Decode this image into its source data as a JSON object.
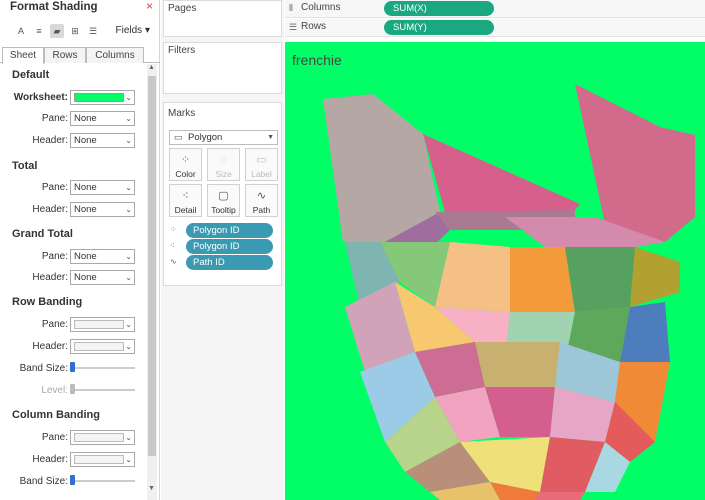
{
  "format_pane": {
    "title": "Format Shading",
    "fields_label": "Fields",
    "tabs": [
      "Sheet",
      "Rows",
      "Columns"
    ],
    "sections": {
      "default": {
        "title": "Default",
        "worksheet_label": "Worksheet:",
        "worksheet_color": "#00ff66",
        "pane_label": "Pane:",
        "pane_value": "None",
        "header_label": "Header:",
        "header_value": "None"
      },
      "total": {
        "title": "Total",
        "pane_label": "Pane:",
        "pane_value": "None",
        "header_label": "Header:",
        "header_value": "None"
      },
      "grand_total": {
        "title": "Grand Total",
        "pane_label": "Pane:",
        "pane_value": "None",
        "header_label": "Header:",
        "header_value": "None"
      },
      "row_banding": {
        "title": "Row Banding",
        "pane_label": "Pane:",
        "header_label": "Header:",
        "band_size_label": "Band Size:",
        "level_label": "Level:"
      },
      "column_banding": {
        "title": "Column Banding",
        "pane_label": "Pane:",
        "header_label": "Header:",
        "band_size_label": "Band Size:"
      }
    }
  },
  "cards": {
    "pages": "Pages",
    "filters": "Filters",
    "marks": {
      "title": "Marks",
      "type": "Polygon",
      "buttons": [
        "Color",
        "Size",
        "Label",
        "Detail",
        "Tooltip",
        "Path"
      ],
      "pills": [
        "Polygon ID",
        "Polygon ID",
        "Path ID"
      ]
    }
  },
  "shelves": {
    "columns": {
      "label": "Columns",
      "pill": "SUM(X)"
    },
    "rows": {
      "label": "Rows",
      "pill": "SUM(Y)"
    }
  },
  "viz": {
    "title": "frenchie",
    "background": "#00ff66",
    "polygons": [
      {
        "points": [
          [
            38,
            57
          ],
          [
            88,
            52
          ],
          [
            138,
            92
          ],
          [
            155,
            170
          ],
          [
            100,
            200
          ],
          [
            58,
            200
          ]
        ],
        "color": "#b5a7a3"
      },
      {
        "points": [
          [
            290,
            42
          ],
          [
            375,
            85
          ],
          [
            410,
            93
          ],
          [
            410,
            175
          ],
          [
            380,
            200
          ],
          [
            320,
            182
          ]
        ],
        "color": "#d26a8c"
      },
      {
        "points": [
          [
            138,
            92
          ],
          [
            165,
            188
          ],
          [
            250,
            188
          ],
          [
            290,
            168
          ],
          [
            295,
            162
          ]
        ],
        "color": "#d65f8c"
      },
      {
        "points": [
          [
            70,
            200
          ],
          [
            100,
            200
          ],
          [
            155,
            170
          ],
          [
            165,
            188
          ],
          [
            125,
            225
          ]
        ],
        "color": "#a06e9e"
      },
      {
        "points": [
          [
            150,
            170
          ],
          [
            290,
            168
          ],
          [
            290,
            188
          ],
          [
            165,
            188
          ]
        ],
        "color": "#a97a92"
      },
      {
        "points": [
          [
            220,
            175
          ],
          [
            310,
            175
          ],
          [
            380,
            200
          ],
          [
            350,
            205
          ],
          [
            260,
            205
          ]
        ],
        "color": "#d38aac"
      },
      {
        "points": [
          [
            60,
            200
          ],
          [
            95,
            200
          ],
          [
            115,
            240
          ],
          [
            75,
            265
          ]
        ],
        "color": "#7eb5b0"
      },
      {
        "points": [
          [
            95,
            200
          ],
          [
            165,
            200
          ],
          [
            150,
            265
          ],
          [
            115,
            240
          ]
        ],
        "color": "#86c87a"
      },
      {
        "points": [
          [
            165,
            200
          ],
          [
            225,
            205
          ],
          [
            225,
            270
          ],
          [
            150,
            265
          ]
        ],
        "color": "#f5c084"
      },
      {
        "points": [
          [
            225,
            205
          ],
          [
            280,
            205
          ],
          [
            290,
            270
          ],
          [
            225,
            270
          ]
        ],
        "color": "#f39b3a"
      },
      {
        "points": [
          [
            280,
            205
          ],
          [
            350,
            205
          ],
          [
            345,
            265
          ],
          [
            290,
            270
          ]
        ],
        "color": "#56a060"
      },
      {
        "points": [
          [
            350,
            205
          ],
          [
            395,
            220
          ],
          [
            395,
            250
          ],
          [
            345,
            265
          ]
        ],
        "color": "#b2a030"
      },
      {
        "points": [
          [
            60,
            265
          ],
          [
            110,
            240
          ],
          [
            130,
            310
          ],
          [
            80,
            330
          ]
        ],
        "color": "#d0a3b8"
      },
      {
        "points": [
          [
            110,
            240
          ],
          [
            150,
            265
          ],
          [
            190,
            300
          ],
          [
            130,
            310
          ]
        ],
        "color": "#f7c870"
      },
      {
        "points": [
          [
            150,
            265
          ],
          [
            225,
            270
          ],
          [
            220,
            320
          ],
          [
            190,
            300
          ]
        ],
        "color": "#f8b0c5"
      },
      {
        "points": [
          [
            225,
            270
          ],
          [
            290,
            270
          ],
          [
            280,
            320
          ],
          [
            220,
            320
          ]
        ],
        "color": "#a2d3b0"
      },
      {
        "points": [
          [
            290,
            270
          ],
          [
            345,
            265
          ],
          [
            335,
            320
          ],
          [
            280,
            320
          ]
        ],
        "color": "#5da85a"
      },
      {
        "points": [
          [
            345,
            265
          ],
          [
            380,
            260
          ],
          [
            385,
            320
          ],
          [
            335,
            320
          ]
        ],
        "color": "#4d7dbd"
      },
      {
        "points": [
          [
            75,
            330
          ],
          [
            130,
            310
          ],
          [
            150,
            355
          ],
          [
            100,
            400
          ]
        ],
        "color": "#9ccbe8"
      },
      {
        "points": [
          [
            130,
            310
          ],
          [
            190,
            300
          ],
          [
            200,
            345
          ],
          [
            150,
            355
          ]
        ],
        "color": "#ce6d94"
      },
      {
        "points": [
          [
            190,
            300
          ],
          [
            275,
            300
          ],
          [
            270,
            345
          ],
          [
            200,
            345
          ]
        ],
        "color": "#c8b070"
      },
      {
        "points": [
          [
            275,
            300
          ],
          [
            335,
            320
          ],
          [
            330,
            360
          ],
          [
            270,
            345
          ]
        ],
        "color": "#9ec6d9"
      },
      {
        "points": [
          [
            335,
            320
          ],
          [
            385,
            320
          ],
          [
            370,
            400
          ],
          [
            330,
            360
          ]
        ],
        "color": "#f08a36"
      },
      {
        "points": [
          [
            100,
            400
          ],
          [
            150,
            355
          ],
          [
            175,
            400
          ],
          [
            120,
            430
          ]
        ],
        "color": "#b8d38a"
      },
      {
        "points": [
          [
            150,
            355
          ],
          [
            200,
            345
          ],
          [
            215,
            395
          ],
          [
            175,
            400
          ]
        ],
        "color": "#f2a3bf"
      },
      {
        "points": [
          [
            200,
            345
          ],
          [
            270,
            345
          ],
          [
            265,
            395
          ],
          [
            215,
            395
          ]
        ],
        "color": "#d45f8f"
      },
      {
        "points": [
          [
            270,
            345
          ],
          [
            330,
            360
          ],
          [
            320,
            400
          ],
          [
            265,
            395
          ]
        ],
        "color": "#e8a6c6"
      },
      {
        "points": [
          [
            330,
            360
          ],
          [
            370,
            400
          ],
          [
            345,
            420
          ],
          [
            320,
            400
          ]
        ],
        "color": "#e55a5a"
      },
      {
        "points": [
          [
            120,
            430
          ],
          [
            175,
            400
          ],
          [
            205,
            440
          ],
          [
            145,
            450
          ]
        ],
        "color": "#b98f7a"
      },
      {
        "points": [
          [
            175,
            400
          ],
          [
            265,
            395
          ],
          [
            255,
            450
          ],
          [
            205,
            440
          ]
        ],
        "color": "#f0e07a"
      },
      {
        "points": [
          [
            265,
            395
          ],
          [
            320,
            400
          ],
          [
            300,
            450
          ],
          [
            255,
            450
          ]
        ],
        "color": "#e05c62"
      },
      {
        "points": [
          [
            320,
            400
          ],
          [
            345,
            420
          ],
          [
            330,
            450
          ],
          [
            300,
            450
          ]
        ],
        "color": "#a9d8e2"
      },
      {
        "points": [
          [
            145,
            450
          ],
          [
            205,
            440
          ],
          [
            215,
            458
          ],
          [
            155,
            458
          ]
        ],
        "color": "#e7c26a"
      },
      {
        "points": [
          [
            205,
            440
          ],
          [
            255,
            450
          ],
          [
            250,
            458
          ],
          [
            215,
            458
          ]
        ],
        "color": "#f07a3a"
      },
      {
        "points": [
          [
            255,
            450
          ],
          [
            300,
            450
          ],
          [
            295,
            458
          ],
          [
            250,
            458
          ]
        ],
        "color": "#e86b7a"
      }
    ]
  }
}
